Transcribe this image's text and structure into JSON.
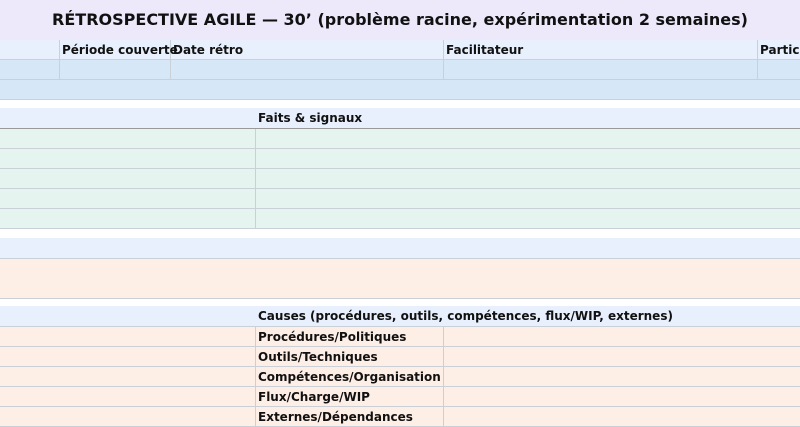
{
  "title": "RÉTROSPECTIVE AGILE — 30’ (problème racine, expérimentation 2 semaines)",
  "header": {
    "columns": [
      "Période couverte",
      "Date rétro",
      "Facilitateur",
      "Partici"
    ]
  },
  "facts": {
    "label": "Faits & signaux"
  },
  "causes": {
    "label": "Causes (procédures, outils, compétences, flux/WIP, externes)",
    "items": [
      "Procédures/Politiques",
      "Outils/Techniques",
      "Compétences/Organisation",
      "Flux/Charge/WIP",
      "Externes/Dépendances"
    ]
  },
  "colors": {
    "title_bg": "#ede9fb",
    "header_bg": "#e8f0fd",
    "info_bg": "#d6e8f7",
    "facts_bg": "#e6f4ef",
    "causes_bg": "#fdeee6"
  }
}
